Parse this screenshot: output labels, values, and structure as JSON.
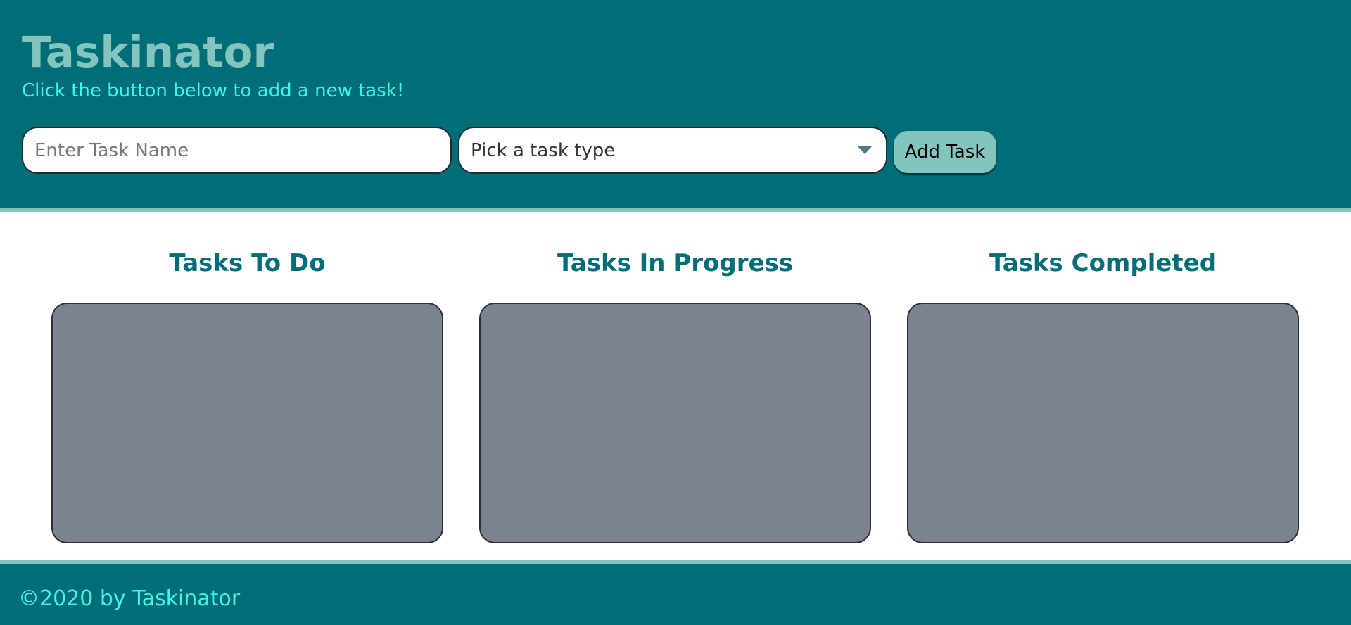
{
  "header": {
    "title": "Taskinator",
    "subtitle": "Click the button below to add a new task!"
  },
  "form": {
    "task_name_placeholder": "Enter Task Name",
    "task_name_value": "",
    "task_type_selected": "Pick a task type",
    "add_button_label": "Add Task"
  },
  "columns": [
    {
      "title": "Tasks To Do",
      "items": []
    },
    {
      "title": "Tasks In Progress",
      "items": []
    },
    {
      "title": "Tasks Completed",
      "items": []
    }
  ],
  "footer": {
    "copyright": "©2020 by Taskinator"
  },
  "colors": {
    "primary": "#006d77",
    "accent": "#83c5be",
    "highlight_text": "#40f5e8",
    "column_background": "#7c828f"
  },
  "icons": {
    "select_caret": "chevron-down-icon"
  }
}
